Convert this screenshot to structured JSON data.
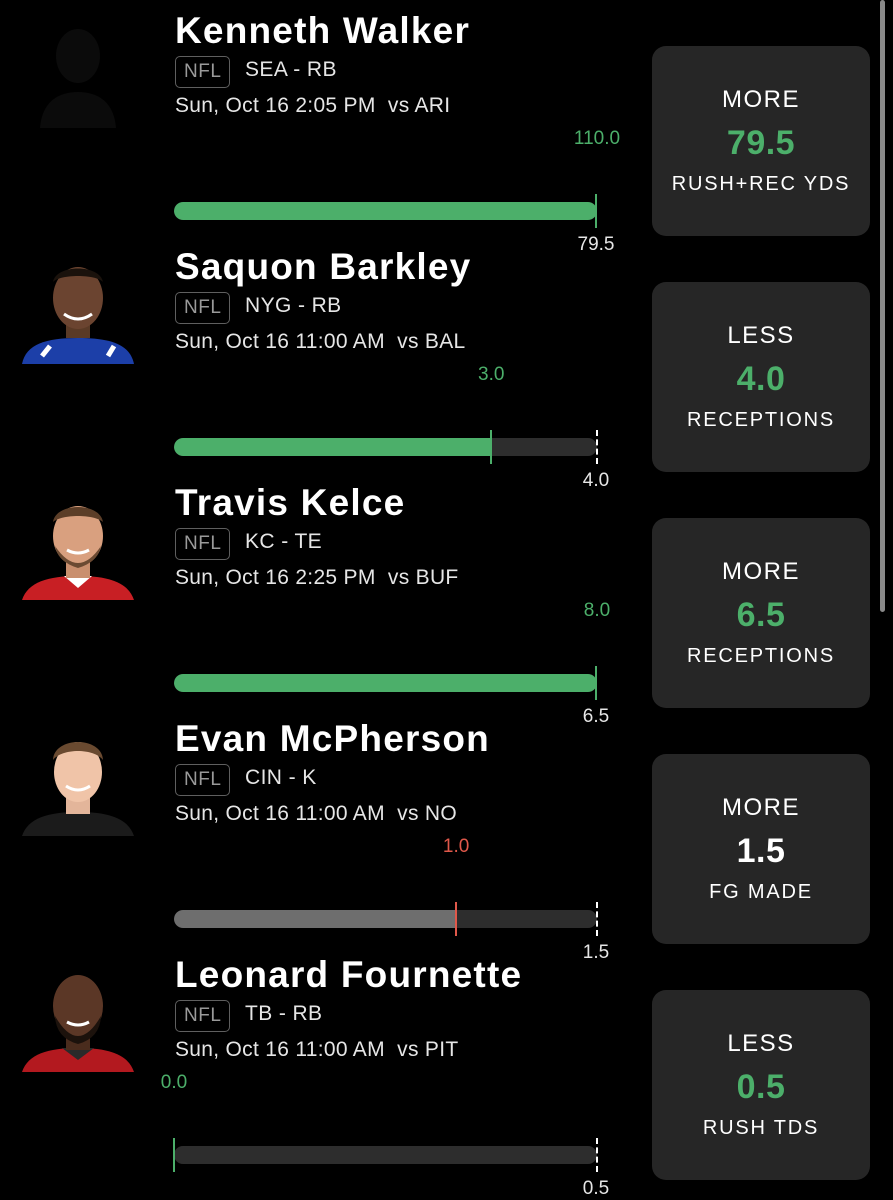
{
  "colors": {
    "win": "#4caf6a",
    "loss": "#e0584a",
    "neutral_fill": "#6e6e6e",
    "track": "#2d2d2d",
    "card": "#262626"
  },
  "picks": [
    {
      "name": "Kenneth Walker",
      "league": "NFL",
      "team_pos": "SEA - RB",
      "game": "Sun, Oct 16 2:05 PM  vs ARI",
      "avatar": "silhouette-avatar",
      "actual": "110.0",
      "actual_value": 110.0,
      "line": "79.5",
      "line_value": 79.5,
      "progress": 1.0,
      "fill_state": "win",
      "label_state": "win",
      "line_dashed": false,
      "direction": "MORE",
      "stat": "RUSH+REC YDS",
      "value_state": "win"
    },
    {
      "name": "Saquon Barkley",
      "league": "NFL",
      "team_pos": "NYG - RB",
      "game": "Sun, Oct 16 11:00 AM  vs BAL",
      "avatar": "player-headshot",
      "actual": "3.0",
      "actual_value": 3.0,
      "line": "4.0",
      "line_value": 4.0,
      "progress": 0.75,
      "fill_state": "win",
      "label_state": "win",
      "line_dashed": true,
      "direction": "LESS",
      "stat": "RECEPTIONS",
      "value_state": "win"
    },
    {
      "name": "Travis Kelce",
      "league": "NFL",
      "team_pos": "KC - TE",
      "game": "Sun, Oct 16 2:25 PM  vs BUF",
      "avatar": "player-headshot",
      "actual": "8.0",
      "actual_value": 8.0,
      "line": "6.5",
      "line_value": 6.5,
      "progress": 1.0,
      "fill_state": "win",
      "label_state": "win",
      "line_dashed": false,
      "direction": "MORE",
      "stat": "RECEPTIONS",
      "value_state": "win"
    },
    {
      "name": "Evan McPherson",
      "league": "NFL",
      "team_pos": "CIN - K",
      "game": "Sun, Oct 16 11:00 AM  vs NO",
      "avatar": "player-headshot",
      "actual": "1.0",
      "actual_value": 1.0,
      "line": "1.5",
      "line_value": 1.5,
      "progress": 0.667,
      "fill_state": "neutral",
      "label_state": "loss",
      "line_dashed": true,
      "direction": "MORE",
      "stat": "FG MADE",
      "value_state": "neutral"
    },
    {
      "name": "Leonard Fournette",
      "league": "NFL",
      "team_pos": "TB - RB",
      "game": "Sun, Oct 16 11:00 AM  vs PIT",
      "avatar": "player-headshot",
      "actual": "0.0",
      "actual_value": 0.0,
      "line": "0.5",
      "line_value": 0.5,
      "progress": 0.0,
      "fill_state": "win",
      "label_state": "win",
      "line_dashed": true,
      "direction": "LESS",
      "stat": "RUSH TDS",
      "value_state": "win"
    }
  ]
}
